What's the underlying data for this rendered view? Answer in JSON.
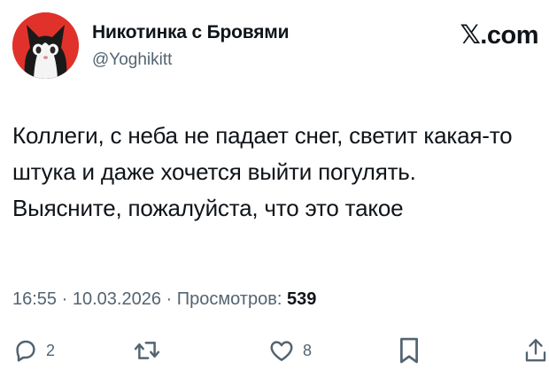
{
  "author": {
    "display_name": "Никотинка с Бровями",
    "handle": "@Yoghikitt",
    "avatar_icon": "cat-avatar",
    "avatar_bg": "#e0322a"
  },
  "brand": {
    "label": "𝕏.com"
  },
  "tweet": {
    "text": "Коллеги, с неба не падает снег, светит какая-то штука и даже хочется выйти погулять. Выясните, пожалуйста, что это такое"
  },
  "meta": {
    "time": "16:55",
    "separator": " · ",
    "date": "10.03.2026",
    "views_label": "Просмотров:",
    "views_count": "539"
  },
  "actions": {
    "replies": {
      "icon": "reply-icon",
      "count": "2"
    },
    "retweets": {
      "icon": "retweet-icon",
      "count": ""
    },
    "likes": {
      "icon": "heart-icon",
      "count": "8"
    },
    "bookmark": {
      "icon": "bookmark-icon"
    },
    "share": {
      "icon": "share-icon"
    }
  },
  "colors": {
    "text": "#0f1419",
    "secondary": "#536471"
  }
}
